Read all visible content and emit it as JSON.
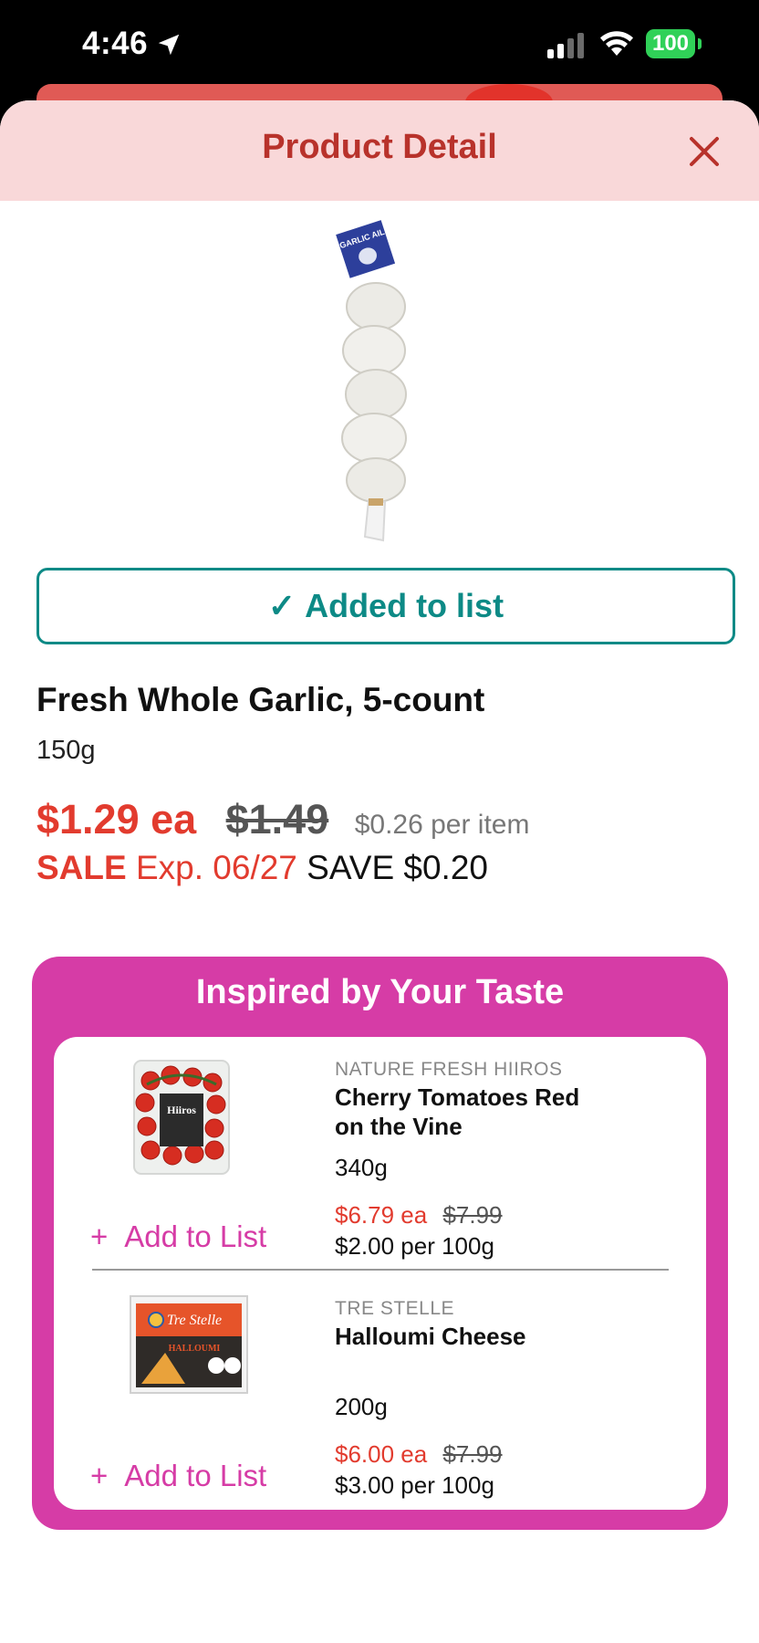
{
  "status_bar": {
    "time": "4:46",
    "battery": "100"
  },
  "header": {
    "title": "Product Detail"
  },
  "product": {
    "added_label": "Added to list",
    "name": "Fresh Whole Garlic,  5-count",
    "size": "150g",
    "price": "$1.29 ea",
    "was_price": "$1.49",
    "unit_price": "$0.26 per item",
    "sale_label": "SALE",
    "sale_expiry": "Exp. 06/27",
    "savings": "SAVE $0.20"
  },
  "inspired": {
    "title": "Inspired by Your Taste",
    "items": [
      {
        "brand": "NATURE FRESH HIIROS",
        "name": "Cherry Tomatoes Red on the Vine",
        "size": "340g",
        "price": "$6.79 ea",
        "was_price": "$7.99",
        "unit_price": "$2.00 per 100g",
        "add_label": "Add to List",
        "image_text": "Hiiros"
      },
      {
        "brand": "TRE STELLE",
        "name": "Halloumi Cheese",
        "size": "200g",
        "price": "$6.00 ea",
        "was_price": "$7.99",
        "unit_price": "$3.00 per 100g",
        "add_label": "Add to List",
        "image_text": "Tre Stelle",
        "image_subtext": "HALLOUMI"
      }
    ]
  },
  "garlic_tag_text": "GARLIC AIL",
  "colors": {
    "brand_red": "#e23b2e",
    "teal": "#0d8a86",
    "magenta": "#d63ca6",
    "header_pink": "#f9d8d9"
  }
}
